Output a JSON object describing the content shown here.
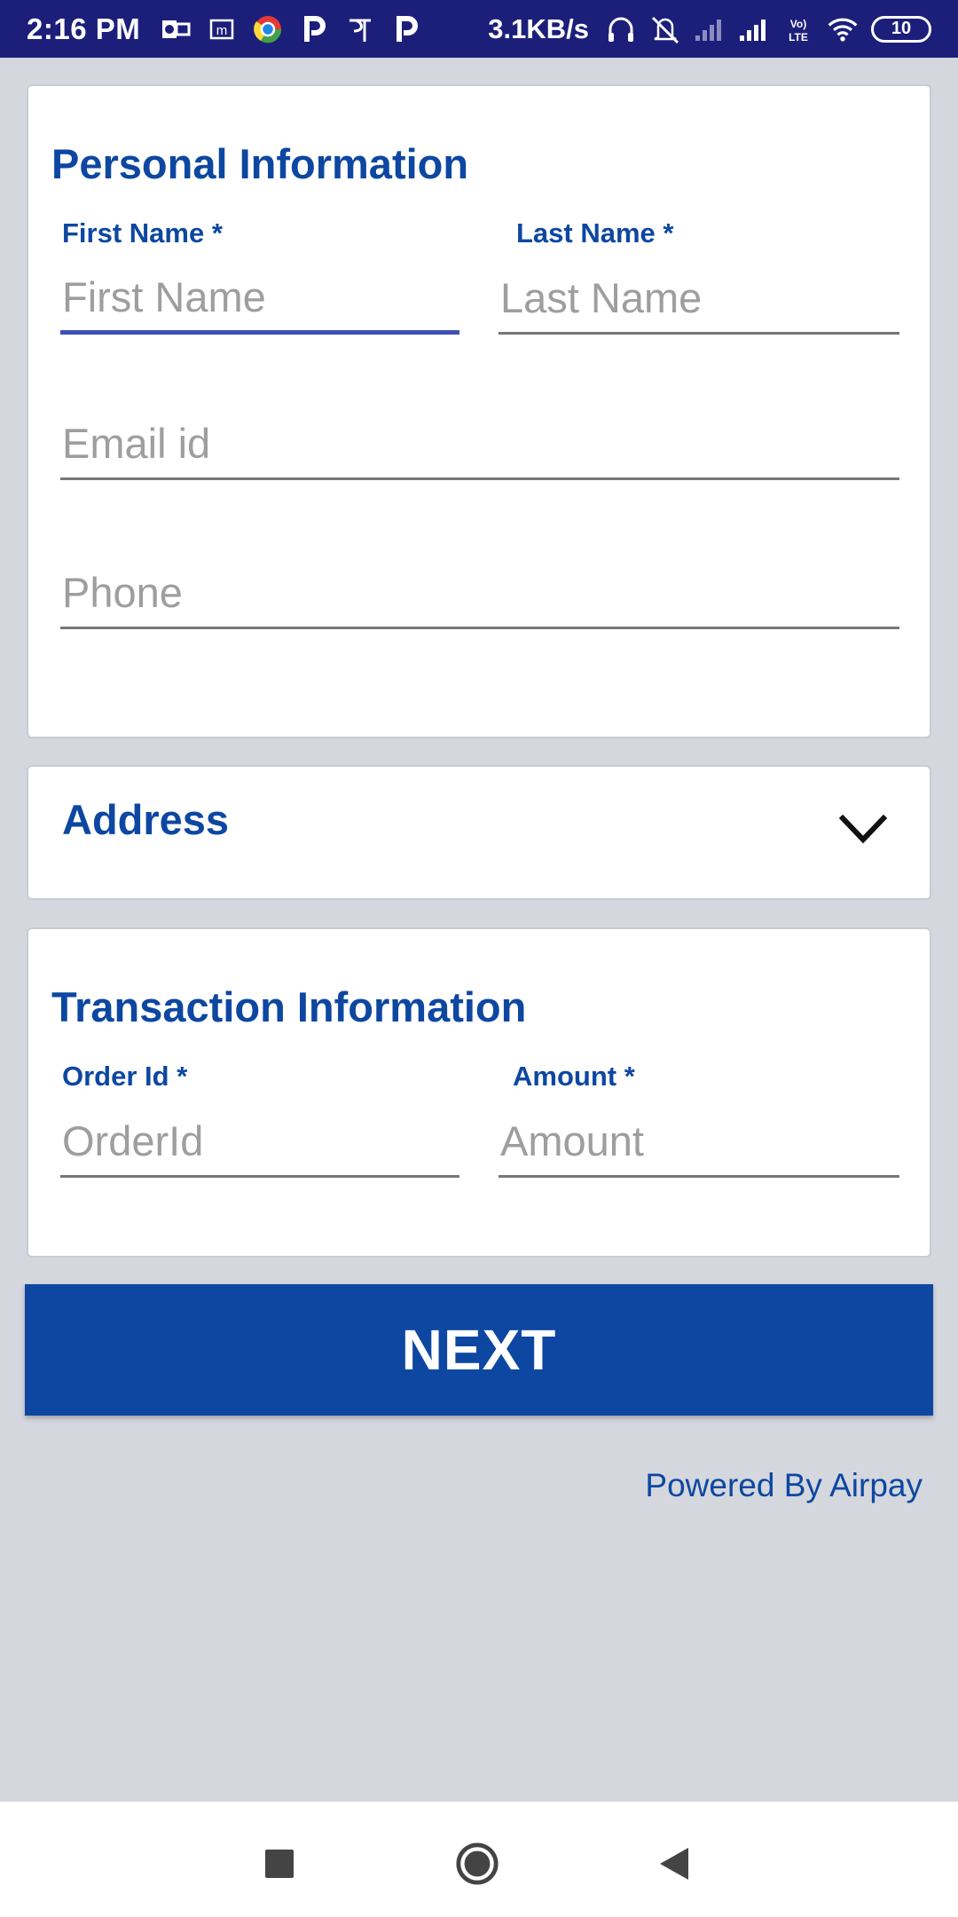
{
  "status_bar": {
    "time": "2:16 PM",
    "network_speed": "3.1KB/s",
    "network_type": "Vo) LTE",
    "battery_level": "10",
    "notification_icons": [
      "outlook-icon",
      "m-icon",
      "chrome-icon",
      "paytm-p-icon",
      "phonepe-icon",
      "paytm-p-icon"
    ],
    "system_icons": [
      "headset-icon",
      "mute-icon",
      "signal-icon",
      "signal-icon",
      "volte-icon",
      "wifi-icon",
      "battery-icon"
    ]
  },
  "personal_information": {
    "title": "Personal Information",
    "first_name": {
      "label": "First Name *",
      "placeholder": "First Name",
      "value": ""
    },
    "last_name": {
      "label": "Last Name *",
      "placeholder": "Last Name",
      "value": ""
    },
    "email": {
      "placeholder": "Email id",
      "value": ""
    },
    "phone": {
      "placeholder": "Phone",
      "value": ""
    }
  },
  "address": {
    "title": "Address",
    "icon": "chevron-down-icon"
  },
  "transaction_information": {
    "title": "Transaction Information",
    "order_id": {
      "label": "Order Id *",
      "placeholder": "OrderId",
      "value": ""
    },
    "amount": {
      "label": "Amount *",
      "placeholder": "Amount",
      "value": ""
    }
  },
  "next_button": {
    "label": "NEXT",
    "color": "#0d47a1"
  },
  "footer": {
    "powered_by": "Powered By Airpay"
  },
  "colors": {
    "accent": "#0d47a1",
    "focus_underline": "#3f51b5",
    "status_bar": "#1c1f7a",
    "background": "#d4d7dd"
  },
  "nav_bar": {
    "buttons": [
      "recents-square-icon",
      "home-circle-icon",
      "back-triangle-icon"
    ]
  }
}
